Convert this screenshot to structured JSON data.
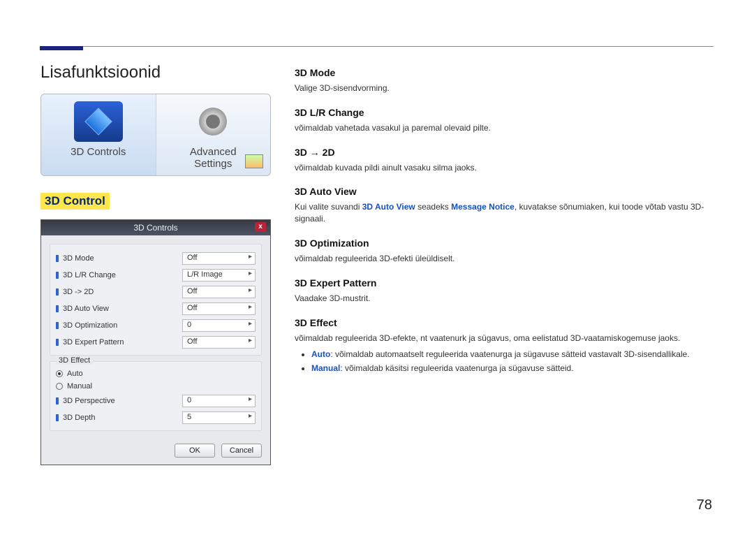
{
  "page_title": "Lisafunktsioonid",
  "page_number": "78",
  "gallery": {
    "tiles": [
      {
        "label": "3D Controls"
      },
      {
        "label": "Advanced\nSettings"
      }
    ]
  },
  "left_section_heading": "3D Control",
  "dialog": {
    "title": "3D Controls",
    "close": "x",
    "rows": [
      {
        "label": "3D Mode",
        "value": "Off"
      },
      {
        "label": "3D L/R Change",
        "value": "L/R Image"
      },
      {
        "label": "3D -> 2D",
        "value": "Off"
      },
      {
        "label": "3D Auto View",
        "value": "Off"
      },
      {
        "label": "3D Optimization",
        "value": "0"
      },
      {
        "label": "3D Expert Pattern",
        "value": "Off"
      }
    ],
    "effect_group_label": "3D Effect",
    "radios": [
      {
        "label": "Auto",
        "checked": true
      },
      {
        "label": "Manual",
        "checked": false
      }
    ],
    "effect_rows": [
      {
        "label": "3D Perspective",
        "value": "0"
      },
      {
        "label": "3D Depth",
        "value": "5"
      }
    ],
    "ok": "OK",
    "cancel": "Cancel"
  },
  "right": {
    "sections": [
      {
        "heading": "3D Mode",
        "desc": "Valige 3D-sisendvorming."
      },
      {
        "heading": "3D L/R Change",
        "desc": "võimaldab vahetada vasakul ja paremal olevaid pilte."
      },
      {
        "heading": "3D → 2D",
        "desc": "võimaldab kuvada pildi ainult vasaku silma jaoks."
      },
      {
        "heading": "3D Auto View",
        "desc_pre": "Kui valite suvandi ",
        "term1": "3D Auto View",
        "mid": " seadeks ",
        "term2": "Message Notice",
        "desc_post": ", kuvatakse sõnumiaken, kui toode võtab vastu 3D-signaali."
      },
      {
        "heading": "3D Optimization",
        "desc": "võimaldab reguleerida 3D-efekti üleüldiselt."
      },
      {
        "heading": "3D Expert Pattern",
        "desc": "Vaadake 3D-mustrit."
      },
      {
        "heading": "3D Effect",
        "desc": "võimaldab reguleerida 3D-efekte, nt vaatenurk ja sügavus, oma eelistatud 3D-vaatamiskogemuse jaoks."
      }
    ],
    "effect_bullets": [
      {
        "term": "Auto",
        "text": ": võimaldab automaatselt reguleerida vaatenurga ja sügavuse sätteid vastavalt 3D-sisendallikale."
      },
      {
        "term": "Manual",
        "text": ": võimaldab käsitsi reguleerida vaatenurga ja sügavuse sätteid."
      }
    ]
  }
}
